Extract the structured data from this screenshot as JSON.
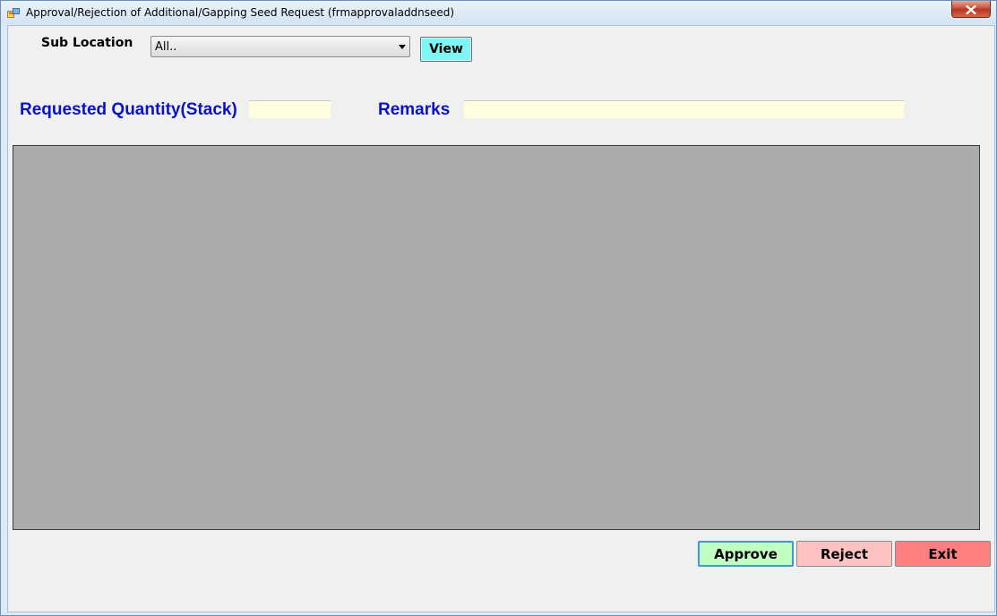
{
  "window": {
    "title": "Approval/Rejection of Additional/Gapping Seed Request (frmapprovaladdnseed)",
    "icon": "app-form-icon",
    "close_icon": "close-icon"
  },
  "filters": {
    "sub_location_label": "Sub Location",
    "sub_location_value": "All..",
    "view_label": "View"
  },
  "fields": {
    "requested_quantity_label": "Requested Quantity(Stack)",
    "requested_quantity_value": "",
    "remarks_label": "Remarks",
    "remarks_value": ""
  },
  "actions": {
    "approve_label": "Approve",
    "reject_label": "Reject",
    "exit_label": "Exit"
  },
  "colors": {
    "label_blue": "#0a12c7",
    "view_button": "#7ff6f6",
    "approve_button": "#c2ffc2",
    "reject_button": "#ffc2c2",
    "exit_button": "#ff8080",
    "input_background": "#ffffe0",
    "grid_background": "#ababab"
  }
}
